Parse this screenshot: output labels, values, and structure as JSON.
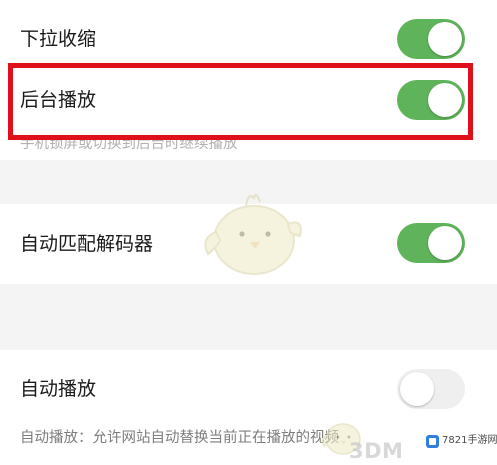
{
  "settings": [
    {
      "label": "下拉收缩",
      "enabled": true
    },
    {
      "label": "后台播放",
      "enabled": true,
      "description": "手机锁屏或切换到后台时继续播放"
    },
    {
      "label": "自动匹配解码器",
      "enabled": true
    },
    {
      "label": "自动播放",
      "enabled": false,
      "description": "自动播放：允许网站自动替换当前正在播放的视频"
    }
  ],
  "watermark": {
    "brand": "3DM",
    "site": "7821手游网"
  },
  "colors": {
    "toggle_on": "#5fb35a",
    "toggle_off": "#efefef",
    "highlight_border": "#e0101a",
    "section_gap": "#f4f4f4",
    "description_text": "#7d7d7d"
  }
}
